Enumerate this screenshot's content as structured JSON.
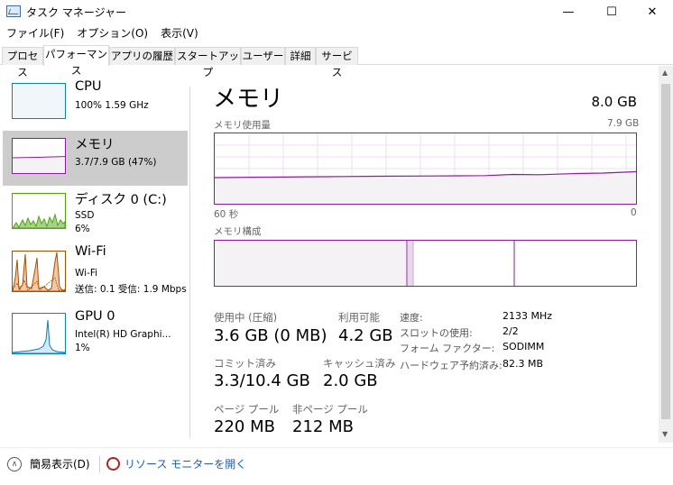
{
  "window": {
    "title": "タスク マネージャー",
    "controls": {
      "minimize": "—",
      "maximize": "☐",
      "close": "✕"
    }
  },
  "menu": [
    "ファイル(F)",
    "オプション(O)",
    "表示(V)"
  ],
  "tabs": [
    "プロセス",
    "パフォーマンス",
    "アプリの履歴",
    "スタートアップ",
    "ユーザー",
    "詳細",
    "サービス"
  ],
  "active_tab": "パフォーマンス",
  "sidebar": {
    "items": [
      {
        "title": "CPU",
        "line1": "100%  1.59 GHz",
        "line2": ""
      },
      {
        "title": "メモリ",
        "line1": "3.7/7.9 GB (47%)",
        "line2": ""
      },
      {
        "title": "ディスク 0 (C:)",
        "line1": "SSD",
        "line2": "6%"
      },
      {
        "title": "Wi-Fi",
        "line1": "Wi-Fi",
        "line2": "送信: 0.1  受信: 1.9 Mbps"
      },
      {
        "title": "GPU 0",
        "line1": "Intel(R) HD Graphi...",
        "line2": "1%"
      }
    ],
    "selected": "メモリ"
  },
  "main": {
    "title": "メモリ",
    "total": "8.0 GB",
    "usage_label": "メモリ使用量",
    "usage_max": "7.9 GB",
    "time_left": "60 秒",
    "time_right": "0",
    "composition_label": "メモリ構成",
    "stats": {
      "in_use_label": "使用中 (圧縮)",
      "in_use_value": "3.6 GB (0 MB)",
      "available_label": "利用可能",
      "available_value": "4.2 GB",
      "committed_label": "コミット済み",
      "committed_value": "3.3/10.4 GB",
      "cached_label": "キャッシュ済み",
      "cached_value": "2.0 GB",
      "paged_label": "ページ プール",
      "paged_value": "220 MB",
      "nonpaged_label": "非ページ プール",
      "nonpaged_value": "212 MB"
    },
    "properties": [
      {
        "label": "速度:",
        "value": "2133 MHz"
      },
      {
        "label": "スロットの使用:",
        "value": "2/2"
      },
      {
        "label": "フォーム ファクター:",
        "value": "SODIMM"
      },
      {
        "label": "ハードウェア予約済み:",
        "value": "82.3 MB"
      }
    ]
  },
  "bottom": {
    "fewer_details": "簡易表示(D)",
    "resource_monitor": "リソース モニターを開く"
  },
  "colors": {
    "memory_accent": "#8b1c9e",
    "cpu_accent": "#117dbb",
    "disk_accent": "#4da60c",
    "wifi_accent": "#a74f01",
    "link": "#1a5fb4"
  },
  "icons": {
    "fewer": "chevron-up-icon",
    "resmon": "resource-monitor-icon"
  }
}
